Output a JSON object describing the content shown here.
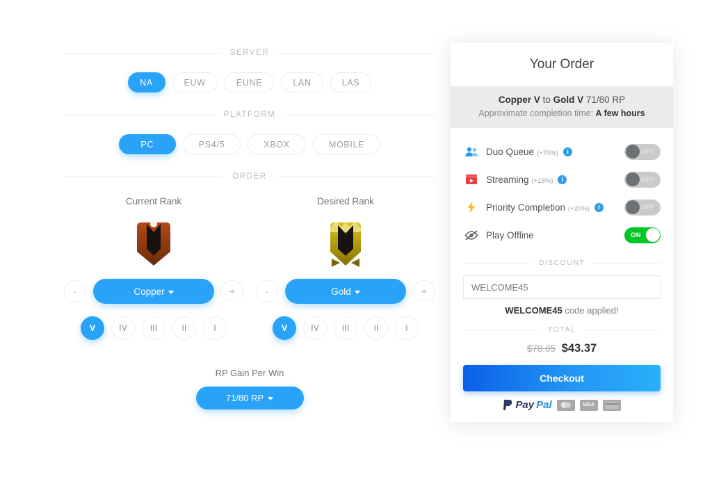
{
  "sections": {
    "server_label": "SERVER",
    "platform_label": "PLATFORM",
    "order_label": "ORDER",
    "discount_label": "DISCOUNT",
    "total_label": "TOTAL"
  },
  "server": {
    "options": [
      {
        "label": "NA",
        "active": true
      },
      {
        "label": "EUW",
        "active": false
      },
      {
        "label": "EUNE",
        "active": false
      },
      {
        "label": "LAN",
        "active": false
      },
      {
        "label": "LAS",
        "active": false
      }
    ]
  },
  "platform": {
    "options": [
      {
        "label": "PC",
        "active": true
      },
      {
        "label": "PS4/5",
        "active": false
      },
      {
        "label": "XBOX",
        "active": false
      },
      {
        "label": "MOBILE",
        "active": false
      }
    ]
  },
  "current_rank": {
    "title": "Current Rank",
    "rank_name": "Copper",
    "badge_color": "#a33f12",
    "decrement": "-",
    "increment": "+",
    "divisions": [
      {
        "label": "V",
        "active": true
      },
      {
        "label": "IV",
        "active": false
      },
      {
        "label": "III",
        "active": false
      },
      {
        "label": "II",
        "active": false
      },
      {
        "label": "I",
        "active": false
      }
    ]
  },
  "desired_rank": {
    "title": "Desired Rank",
    "rank_name": "Gold",
    "badge_color": "#c9ae0c",
    "decrement": "-",
    "increment": "+",
    "divisions": [
      {
        "label": "V",
        "active": true
      },
      {
        "label": "IV",
        "active": false
      },
      {
        "label": "III",
        "active": false
      },
      {
        "label": "II",
        "active": false
      },
      {
        "label": "I",
        "active": false
      }
    ]
  },
  "rp_gain": {
    "label": "RP Gain Per Win",
    "value": "71/80 RP"
  },
  "order": {
    "title": "Your Order",
    "summary_from": "Copper V",
    "summary_to_word": "to",
    "summary_to": "Gold V",
    "summary_rp": "71/80 RP",
    "eta_prefix": "Approximate completion time:",
    "eta_value": "A few hours",
    "options": [
      {
        "name": "Duo Queue",
        "pct": "(+70%)",
        "state": "OFF",
        "on": false,
        "icon": "people-icon",
        "has_info": true
      },
      {
        "name": "Streaming",
        "pct": "(+15%)",
        "state": "OFF",
        "on": false,
        "icon": "streaming-icon",
        "has_info": true
      },
      {
        "name": "Priority Completion",
        "pct": "(+20%)",
        "state": "OFF",
        "on": false,
        "icon": "lightning-icon",
        "has_info": true
      },
      {
        "name": "Play Offline",
        "pct": "",
        "state": "ON",
        "on": true,
        "icon": "eye-off-icon",
        "has_info": false
      }
    ],
    "discount_code_value": "WELCOME45",
    "discount_code_placeholder": "WELCOME45",
    "discount_applied_code": "WELCOME45",
    "discount_applied_text": "code applied!",
    "old_price": "$78.85",
    "new_price": "$43.37",
    "checkout_label": "Checkout",
    "payment_methods": [
      {
        "name": "paypal",
        "text_pay": "Pay",
        "text_pal": "Pal"
      },
      {
        "name": "mastercard",
        "text": ""
      },
      {
        "name": "visa",
        "text": "VISA"
      },
      {
        "name": "card",
        "text": ""
      }
    ]
  },
  "colors": {
    "accent": "#29a3f7",
    "toggle_on": "#00c627",
    "toggle_off": "#c9cacb"
  }
}
